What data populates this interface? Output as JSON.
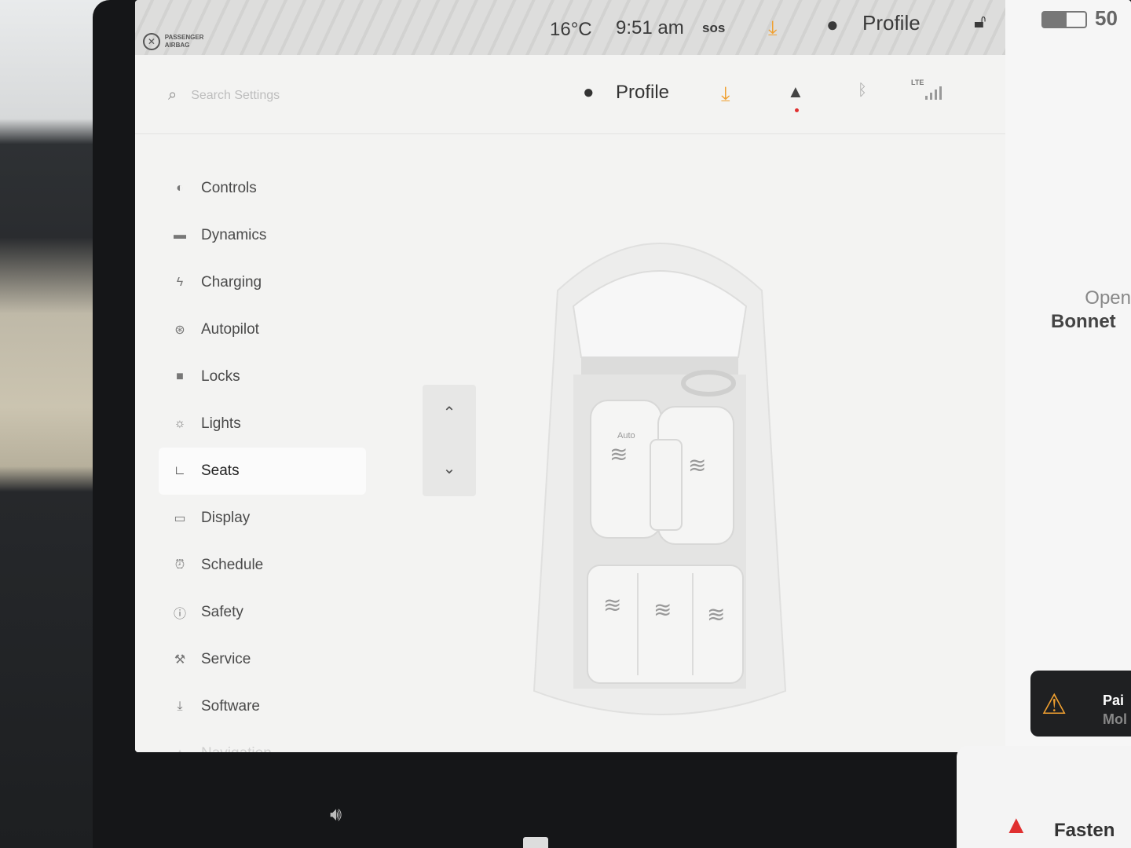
{
  "status_bar": {
    "airbag_label": "PASSENGER AIRBAG",
    "temperature": "16°C",
    "time": "9:51 am",
    "sos": "sos",
    "profile": "Profile",
    "battery_percent": "50"
  },
  "header": {
    "search_placeholder": "Search Settings",
    "profile": "Profile",
    "network": "LTE"
  },
  "sidebar": {
    "items": [
      {
        "label": "Controls",
        "icon": "toggle-icon"
      },
      {
        "label": "Dynamics",
        "icon": "car-icon"
      },
      {
        "label": "Charging",
        "icon": "bolt-icon"
      },
      {
        "label": "Autopilot",
        "icon": "steering-wheel-icon"
      },
      {
        "label": "Locks",
        "icon": "lock-icon"
      },
      {
        "label": "Lights",
        "icon": "light-icon"
      },
      {
        "label": "Seats",
        "icon": "seat-icon",
        "active": true
      },
      {
        "label": "Display",
        "icon": "display-icon"
      },
      {
        "label": "Schedule",
        "icon": "alarm-clock-icon"
      },
      {
        "label": "Safety",
        "icon": "safety-icon"
      },
      {
        "label": "Service",
        "icon": "wrench-icon"
      },
      {
        "label": "Software",
        "icon": "download-icon"
      },
      {
        "label": "Navigation",
        "icon": "navigation-icon"
      }
    ]
  },
  "seats": {
    "driver_seat_mode": "Auto"
  },
  "right_panel": {
    "open_label": "Open",
    "bonnet_label": "Bonnet",
    "alert_title": "Pai",
    "alert_sub": "Mol",
    "fasten_label": "Fasten"
  },
  "colors": {
    "accent_download": "#f0a030",
    "alert_red": "#e03030",
    "screen_bg": "#f3f3f2"
  }
}
